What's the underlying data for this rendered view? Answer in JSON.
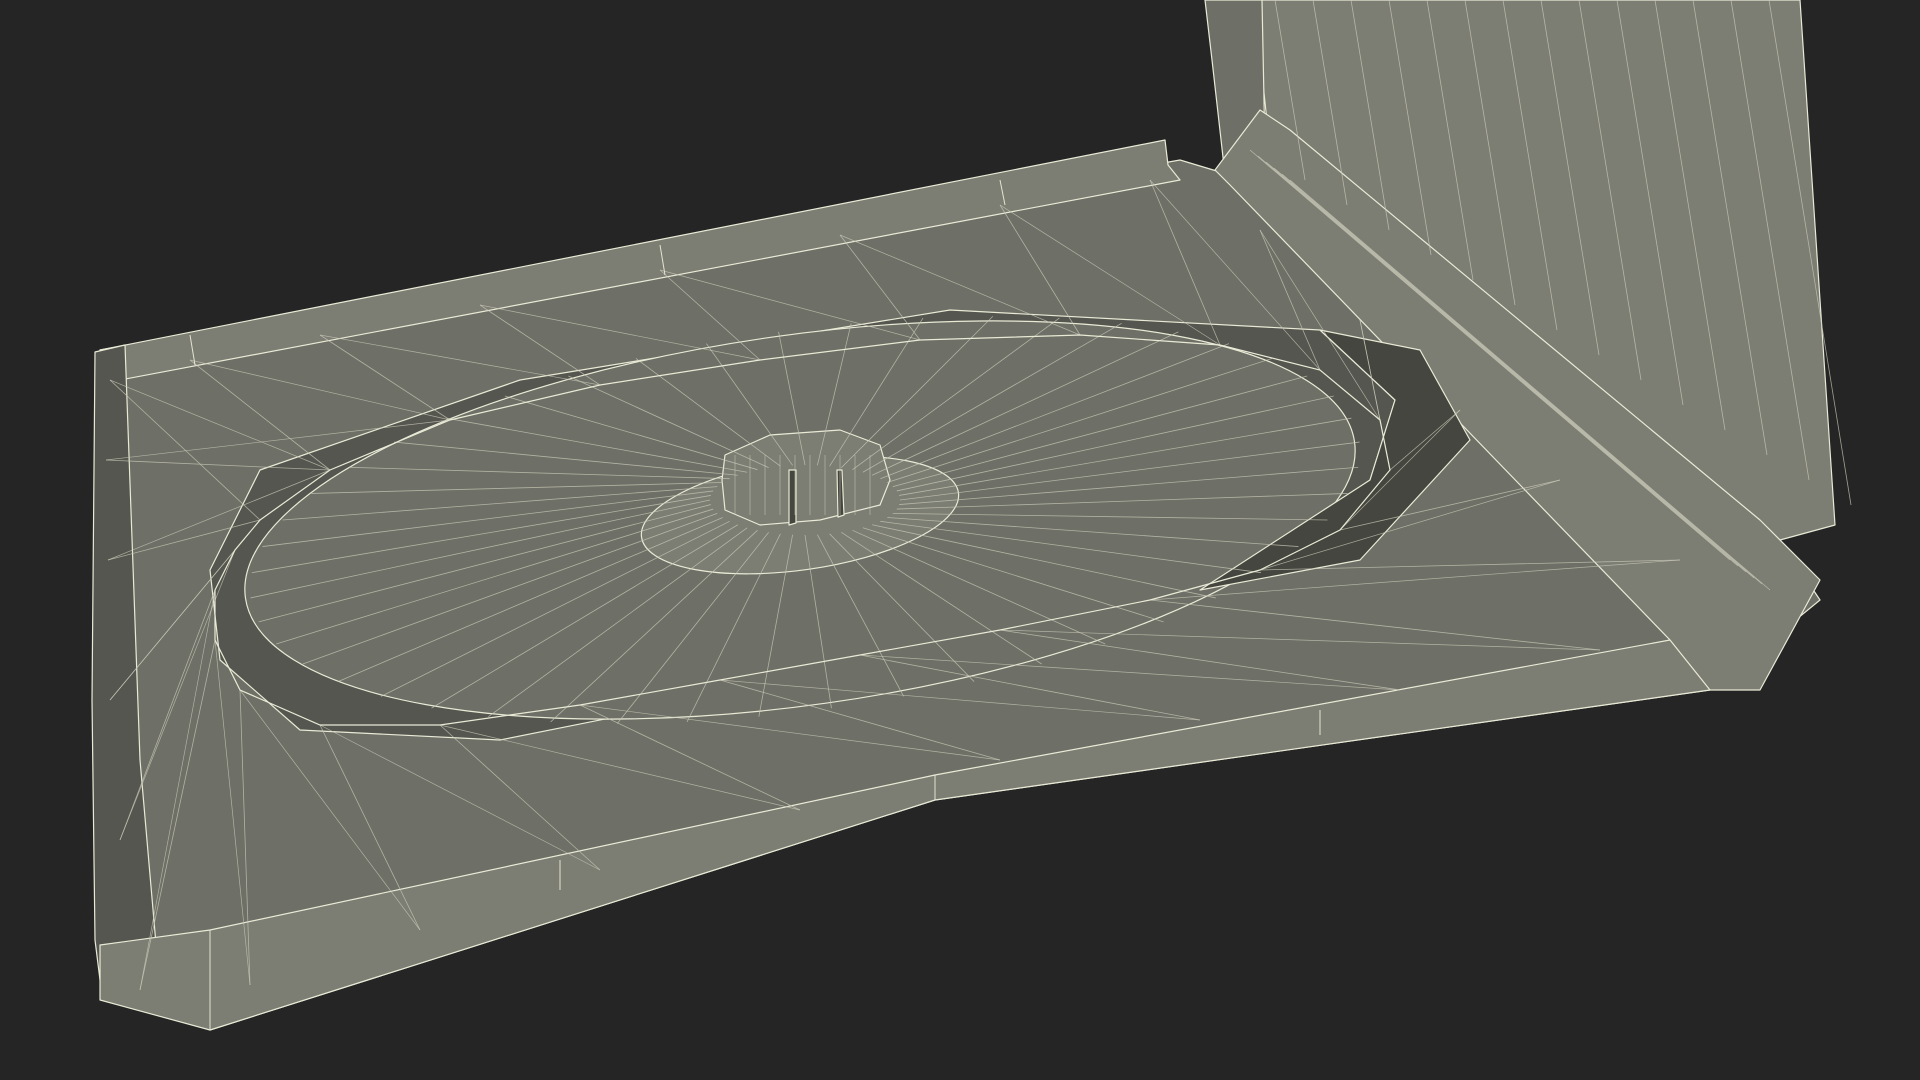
{
  "scene": {
    "background_color": "#252525",
    "surface_color": "#6e6f66",
    "surface_light_color": "#7c7d73",
    "surface_dark_color": "#55564f",
    "shadow_color": "#45463f",
    "wire_color": "#e9ead6",
    "wire_soft_color": "#c9cab8"
  }
}
